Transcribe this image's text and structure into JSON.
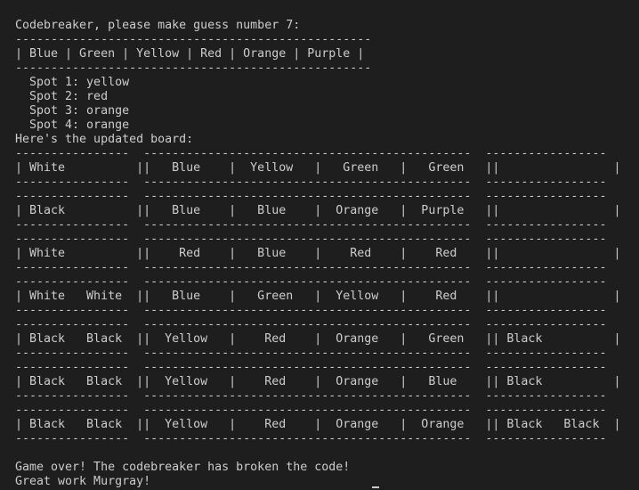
{
  "terminal": {
    "prompt_line": "Codebreaker, please make guess number 7:",
    "colors_divider": "--------------------------------------------------",
    "colors_row": "| Blue | Green | Yellow | Red | Orange | Purple |",
    "spots": [
      "  Spot 1: yellow",
      "  Spot 2: red",
      "  Spot 3: orange",
      "  Spot 4: orange"
    ],
    "updated_board_label": "Here's the updated board:",
    "board_divider": "----------------  ----------------------------------------------  -----------------",
    "board_rows": [
      "| White          ||   Blue    |  Yellow   |   Green   |   Green   ||                |",
      "| Black          ||   Blue    |   Blue    |  Orange   |  Purple   ||                |",
      "| White          ||    Red    |   Blue    |    Red    |    Red    ||                |",
      "| White   White  ||   Blue    |   Green   |  Yellow   |    Red    ||                |",
      "| Black   Black  ||  Yellow   |    Red    |  Orange   |   Green   || Black          |",
      "| Black   Black  ||  Yellow   |    Red    |  Orange   |   Blue    || Black          |",
      "| Black   Black  ||  Yellow   |    Red    |  Orange   |  Orange   || Black   Black  |"
    ],
    "game_over_line": "Game over! The codebreaker has broken the code!",
    "great_work_line": "Great work Murgray!"
  }
}
